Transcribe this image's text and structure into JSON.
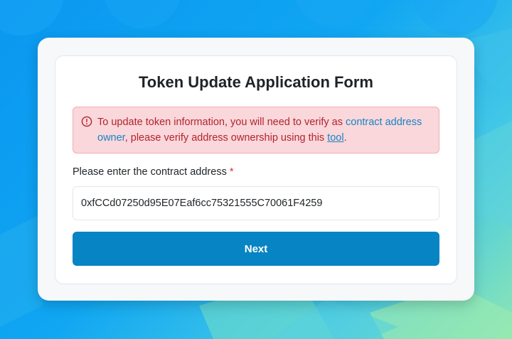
{
  "form": {
    "title": "Token Update Application Form",
    "alert": {
      "icon": "exclamation-circle-icon",
      "text_before": "To update token information, you will need to verify as ",
      "link_owner": "contract address owner",
      "text_middle": ", please verify address ownership using this ",
      "link_tool": "tool",
      "text_after": "."
    },
    "address_label": "Please enter the contract address",
    "required_mark": "*",
    "address_value": "0xfCCd07250d95E07Eaf6cc75321555C70061F4259",
    "next_label": "Next"
  },
  "colors": {
    "primary_button": "#0784c3",
    "alert_bg": "#f9d7da",
    "alert_text": "#b4232f",
    "link": "#1a83c7"
  }
}
